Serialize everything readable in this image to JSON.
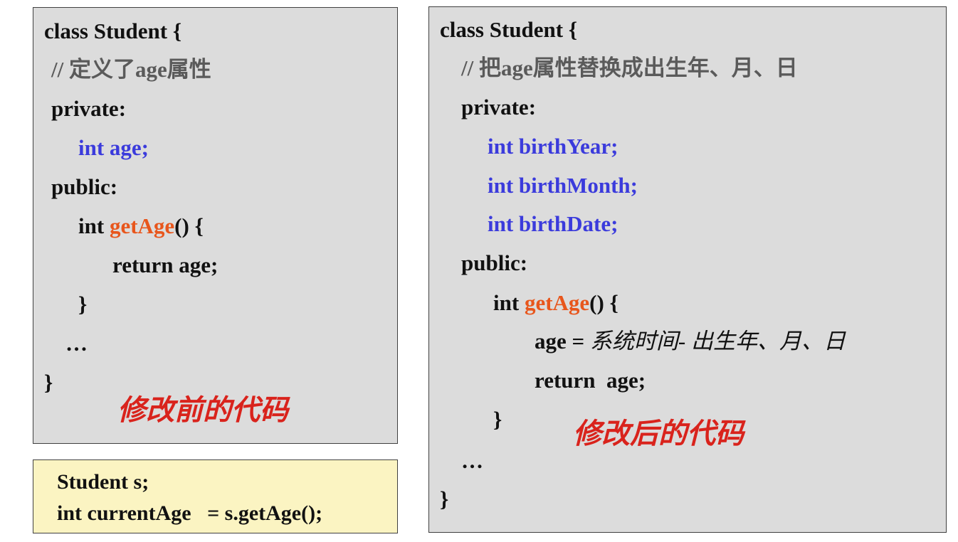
{
  "before": {
    "l1": "class Student {",
    "l2": "// 定义了age属性",
    "l3": "private:",
    "l4": "int age;",
    "l5": "public:",
    "l6a": "int ",
    "l6b": "getAge",
    "l6c": "() {",
    "l7": "return age;",
    "l8": "}",
    "l9": "…",
    "l10": "}",
    "caption": "修改前的代码"
  },
  "usage": {
    "l1": "Student s;",
    "l2": "int currentAge   = s.getAge();"
  },
  "after": {
    "l1": "class Student {",
    "l2": "// 把age属性替换成出生年、月、日",
    "l3": "private:",
    "l4": "int birthYear;",
    "l5": "int birthMonth;",
    "l6": "int birthDate;",
    "l7": "public:",
    "l8a": "int ",
    "l8b": "getAge",
    "l8c": "() {",
    "l9a": "age = ",
    "l9b": "系统时间- 出生年、月、日",
    "l10": "return  age;",
    "l11": "}",
    "l12": "…",
    "l13": "}",
    "caption": "修改后的代码"
  },
  "colors": {
    "comment": "#5a5a5a",
    "declaration": "#3b3bdc",
    "function": "#e8561c",
    "caption": "#d9231c",
    "usage_background": "#fbf4c2",
    "code_background": "#dcdcdc"
  }
}
